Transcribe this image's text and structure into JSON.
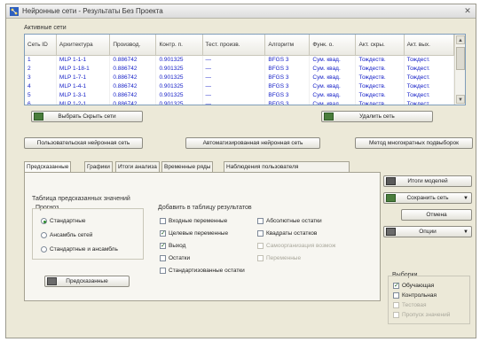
{
  "window": {
    "title": "Нейронные сети - Результаты Без Проекта"
  },
  "active_nets": {
    "group_label": "Активные сети",
    "columns": [
      "Сеть ID",
      "Архитектура",
      "Производ.",
      "Контр. п.",
      "Тест. произв.",
      "Алгоритм",
      "Функ. о.",
      "Акт. скры.",
      "Акт. вых."
    ],
    "rows": [
      [
        "1",
        "MLP 1-1-1",
        "0.886742",
        "0.901325",
        "—",
        "BFGS 3",
        "Сум. квад.",
        "Тождеств.",
        "Тождест."
      ],
      [
        "2",
        "MLP 1-18-1",
        "0.886742",
        "0.901325",
        "—",
        "BFGS 3",
        "Сум. квад.",
        "Тождеств.",
        "Тождест."
      ],
      [
        "3",
        "MLP 1-7-1",
        "0.886742",
        "0.901325",
        "—",
        "BFGS 3",
        "Сум. квад.",
        "Тождеств.",
        "Тождест."
      ],
      [
        "4",
        "MLP 1-4-1",
        "0.886742",
        "0.901325",
        "—",
        "BFGS 3",
        "Сум. квад.",
        "Тождеств.",
        "Тождест."
      ],
      [
        "5",
        "MLP 1-3-1",
        "0.886742",
        "0.901325",
        "—",
        "BFGS 3",
        "Сум. квад.",
        "Тождеств.",
        "Тождест."
      ],
      [
        "6",
        "MLP 1-2-1",
        "0.886742",
        "0.901325",
        "—",
        "BFGS 3",
        "Сум. квад.",
        "Тождеств.",
        "Тождест."
      ]
    ]
  },
  "buttons": {
    "select_all": "Выбрать Скрыть сети",
    "delete_net": "Удалить сеть",
    "user_net": "Пользовательская нейронная сеть",
    "auto_net": "Автоматизированная нейронная сеть",
    "subsample": "Метод многократных подвыборок",
    "models_summary": "Итоги моделей",
    "save_net": "Сохранить сеть",
    "cancel": "Отмена",
    "options": "Опции",
    "predictions": "Предсказанные"
  },
  "tabs": [
    "Предсказанные",
    "Графики",
    "Итоги анализа",
    "Временные ряды",
    "Наблюдения пользователя"
  ],
  "predicted_table": {
    "title": "Таблица предсказанных значений",
    "forecast_label": "Прогноз",
    "radios": [
      {
        "label": "Стандартные",
        "selected": true
      },
      {
        "label": "Ансамбль сетей",
        "selected": false
      },
      {
        "label": "Стандартные и ансамбль",
        "selected": false
      }
    ]
  },
  "add_to_results": {
    "title": "Добавить в таблицу результатов",
    "left": [
      {
        "label": "Входные переменные",
        "checked": false
      },
      {
        "label": "Целевые переменные",
        "checked": true
      },
      {
        "label": "Выход",
        "checked": true
      },
      {
        "label": "Остатки",
        "checked": false
      },
      {
        "label": "Стандартизованные остатки",
        "checked": false
      }
    ],
    "right": [
      {
        "label": "Абсолютные остатки",
        "checked": false,
        "disabled": false
      },
      {
        "label": "Квадраты остатков",
        "checked": false,
        "disabled": false
      },
      {
        "label": "Самоорганизация возмож",
        "checked": false,
        "disabled": true
      },
      {
        "label": "Переменные",
        "checked": false,
        "disabled": true
      }
    ]
  },
  "samples": {
    "title": "Выборки",
    "items": [
      {
        "label": "Обучающая",
        "checked": true,
        "disabled": false
      },
      {
        "label": "Контрольная",
        "checked": false,
        "disabled": false
      },
      {
        "label": "Тестовая",
        "checked": false,
        "disabled": true
      },
      {
        "label": "Пропуск значений",
        "checked": false,
        "disabled": true
      }
    ]
  },
  "colors": {
    "accent_text": "#1822c8",
    "selection": "#2a8a2a"
  }
}
